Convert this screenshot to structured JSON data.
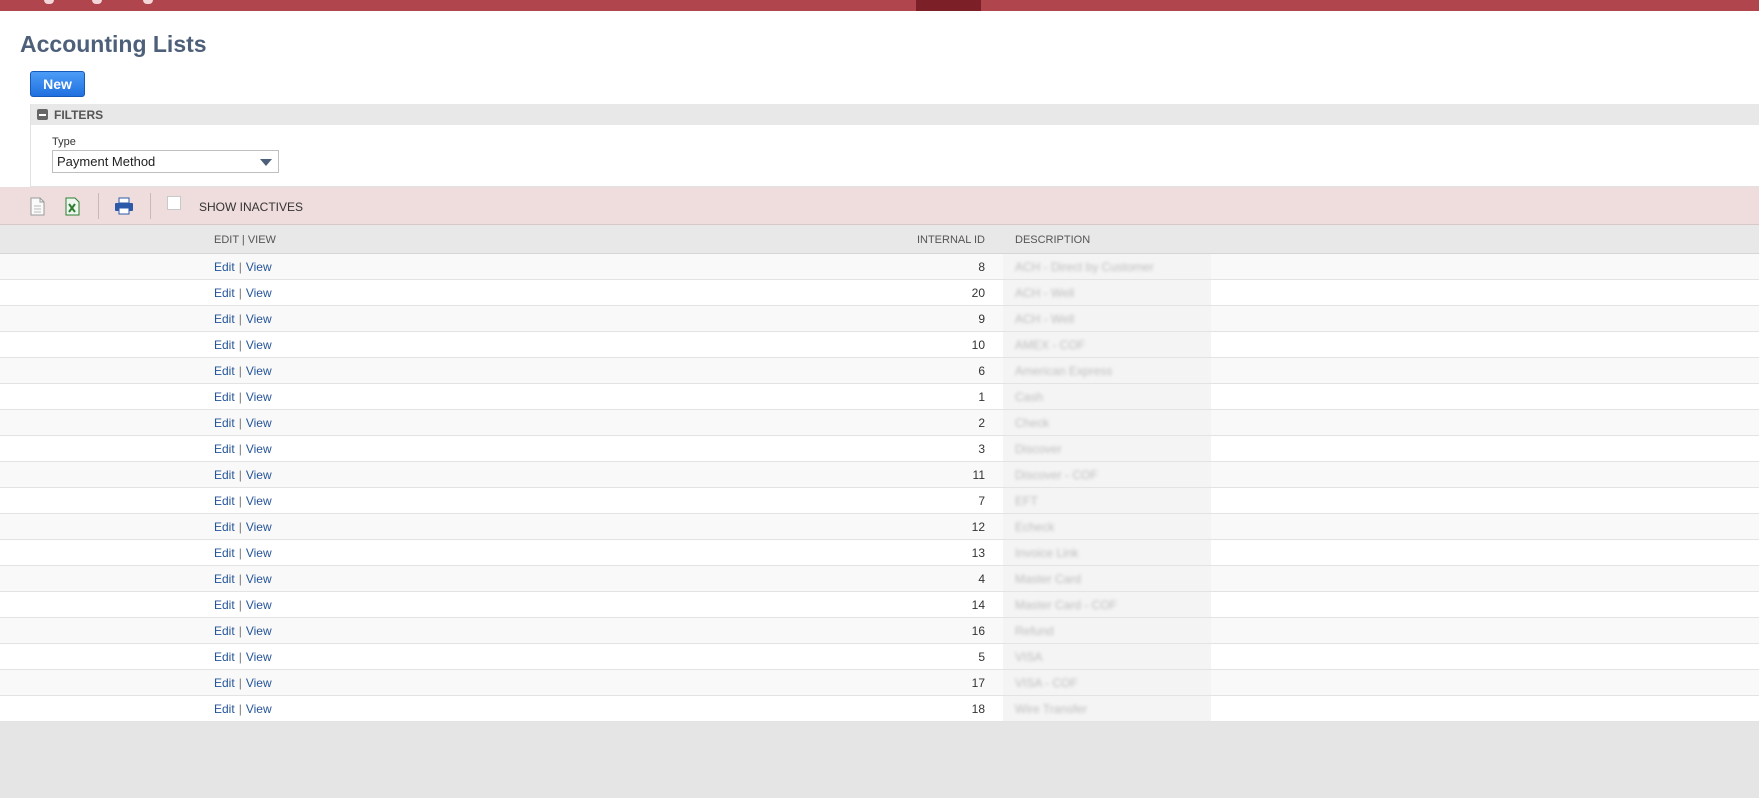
{
  "header": {
    "title": "Accounting Lists",
    "new_label": "New"
  },
  "filters": {
    "title": "FILTERS",
    "type_label": "Type",
    "type_value": "Payment Method"
  },
  "toolbar": {
    "show_inactives_label": "SHOW INACTIVES"
  },
  "table": {
    "columns": {
      "edit_view": "EDIT | VIEW",
      "internal_id": "INTERNAL ID",
      "description": "DESCRIPTION"
    },
    "edit_label": "Edit",
    "separator": "|",
    "view_label": "View",
    "rows": [
      {
        "id": "8",
        "description": "ACH - Direct by Customer"
      },
      {
        "id": "20",
        "description": "ACH - Well"
      },
      {
        "id": "9",
        "description": "ACH - Well"
      },
      {
        "id": "10",
        "description": "AMEX - COF"
      },
      {
        "id": "6",
        "description": "American Express"
      },
      {
        "id": "1",
        "description": "Cash"
      },
      {
        "id": "2",
        "description": "Check"
      },
      {
        "id": "3",
        "description": "Discover"
      },
      {
        "id": "11",
        "description": "Discover - COF"
      },
      {
        "id": "7",
        "description": "EFT"
      },
      {
        "id": "12",
        "description": "Echeck"
      },
      {
        "id": "13",
        "description": "Invoice Link"
      },
      {
        "id": "4",
        "description": "Master Card"
      },
      {
        "id": "14",
        "description": "Master Card - COF"
      },
      {
        "id": "16",
        "description": "Refund"
      },
      {
        "id": "5",
        "description": "VISA"
      },
      {
        "id": "17",
        "description": "VISA - COF"
      },
      {
        "id": "18",
        "description": "Wire Transfer"
      }
    ]
  }
}
